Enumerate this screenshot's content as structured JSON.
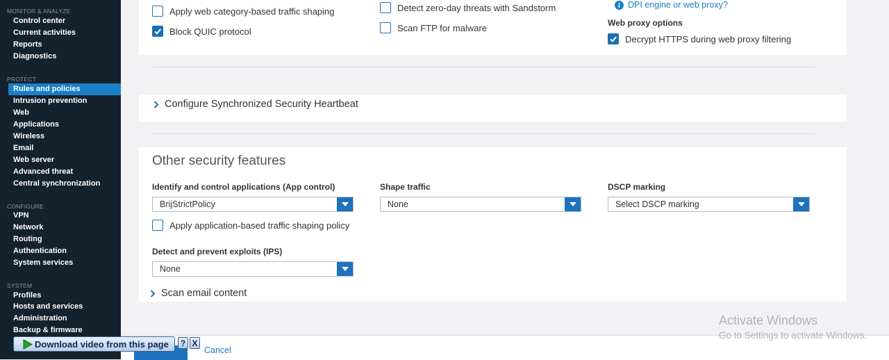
{
  "sidebar": {
    "sections": [
      {
        "heading": "MONITOR & ANALYZE",
        "items": [
          "Control center",
          "Current activities",
          "Reports",
          "Diagnostics"
        ]
      },
      {
        "heading": "PROTECT",
        "items": [
          "Rules and policies",
          "Intrusion prevention",
          "Web",
          "Applications",
          "Wireless",
          "Email",
          "Web server",
          "Advanced threat",
          "Central synchronization"
        ]
      },
      {
        "heading": "CONFIGURE",
        "items": [
          "VPN",
          "Network",
          "Routing",
          "Authentication",
          "System services"
        ]
      },
      {
        "heading": "SYSTEM",
        "items": [
          "Profiles",
          "Hosts and services",
          "Administration",
          "Backup & firmware"
        ]
      }
    ],
    "active_item": "Rules and policies"
  },
  "top_panel": {
    "shaping_checkbox": {
      "label": "Apply web category-based traffic shaping",
      "checked": false
    },
    "quic_checkbox": {
      "label": "Block QUIC protocol",
      "checked": true
    },
    "sandstorm_checkbox": {
      "label": "Detect zero-day threats with Sandstorm",
      "checked": false
    },
    "ftp_checkbox": {
      "label": "Scan FTP for malware",
      "checked": false
    },
    "dpi_link": "DPI engine or web proxy?",
    "web_proxy_heading": "Web proxy options",
    "decrypt_checkbox": {
      "label": "Decrypt HTTPS during web proxy filtering",
      "checked": true
    }
  },
  "heartbeat": {
    "label": "Configure Synchronized Security Heartbeat"
  },
  "other_features": {
    "title": "Other security features",
    "app_control": {
      "label": "Identify and control applications (App control)",
      "value": "BrijStrictPolicy"
    },
    "app_shaping_checkbox": {
      "label": "Apply application-based traffic shaping policy",
      "checked": false
    },
    "shape_traffic": {
      "label": "Shape traffic",
      "value": "None"
    },
    "dscp": {
      "label": "DSCP marking",
      "value": "Select DSCP marking"
    },
    "ips": {
      "label": "Detect and prevent exploits (IPS)",
      "value": "None"
    },
    "scan_email": {
      "label": "Scan email content"
    }
  },
  "footer": {
    "cancel_label": "Cancel"
  },
  "download_bar": {
    "label": "Download video from this page",
    "help": "?",
    "close": "X"
  },
  "watermark": {
    "title": "Activate Windows",
    "subtitle": "Go to Settings to activate Windows."
  },
  "colors": {
    "sidebar_bg": "#14222d",
    "accent": "#1a7fc6",
    "checkbox": "#1d6fb6",
    "link": "#1a7fc6"
  }
}
